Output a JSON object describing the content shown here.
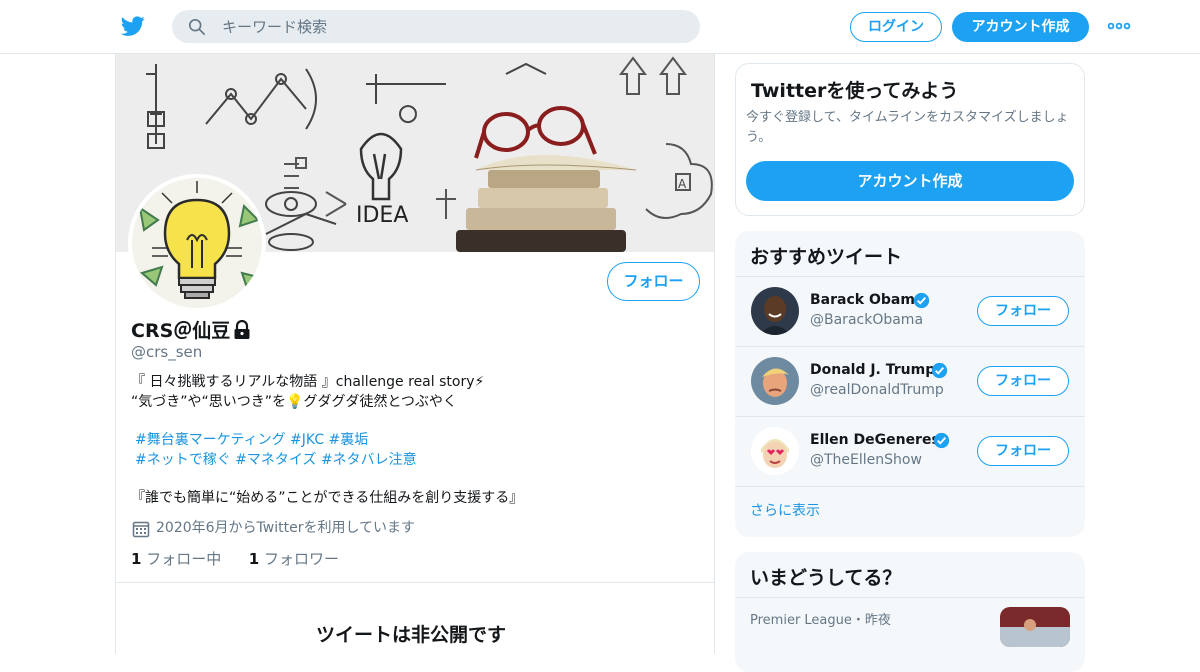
{
  "header": {
    "search_placeholder": "キーワード検索",
    "login_label": "ログイン",
    "signup_label": "アカウント作成",
    "accent_color": "#1da1f2"
  },
  "profile": {
    "name": "CRS＠仙豆",
    "handle": "@crs_sen",
    "follow_label": "フォロー",
    "bio_line1": "『 日々挑戦するリアルな物語 』challenge real story⚡",
    "bio_line2_pre": "“気づき”や“思いつき”を",
    "bio_line2_emoji": "💡",
    "bio_line2_post": "グダグダ徒然とつぶやく",
    "hashtags_line1": "#舞台裏マーケティング #JKC #裏垢",
    "hashtags_line2": "#ネットで稼ぐ #マネタイズ  #ネタバレ注意",
    "mission": "『誰でも簡単に“始める”ことができる仕組みを創り支援する』",
    "joined": "2020年6月からTwitterを利用しています",
    "following_count": "1",
    "following_label": "フォロー中",
    "followers_count": "1",
    "followers_label": "フォロワー",
    "protected_notice": "ツイートは非公開です"
  },
  "try_card": {
    "title": "Twitterを使ってみよう",
    "description": "今すぐ登録して、タイムラインをカスタマイズしましょう。",
    "button": "アカウント作成"
  },
  "recommend": {
    "title": "おすすめツイート",
    "follow_label": "フォロー",
    "accounts": [
      {
        "name": "Barack Obama",
        "handle": "@BarackObama"
      },
      {
        "name": "Donald J. Trump",
        "handle": "@realDonaldTrump"
      },
      {
        "name": "Ellen DeGeneres",
        "handle": "@TheEllenShow"
      }
    ],
    "show_more": "さらに表示"
  },
  "trends": {
    "title": "いまどうしてる？",
    "first_meta": "Premier League・昨夜"
  }
}
